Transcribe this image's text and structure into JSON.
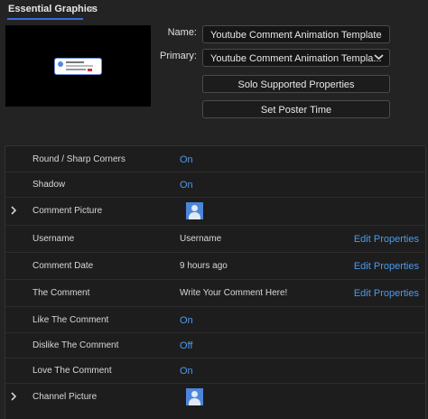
{
  "panel": {
    "title": "Essential Graphics",
    "menu_icon": "≡"
  },
  "template": {
    "name_label": "Name:",
    "name_value": "Youtube Comment Animation Template",
    "primary_label": "Primary:",
    "primary_value": "Youtube Comment Animation Templa...",
    "solo_button": "Solo Supported Properties",
    "poster_button": "Set Poster Time"
  },
  "properties": [
    {
      "label": "Round / Sharp Corners",
      "value": "On",
      "kind": "toggle"
    },
    {
      "label": "Shadow",
      "value": "On",
      "kind": "toggle"
    },
    {
      "label": "Comment Picture",
      "kind": "image",
      "icon": "user-placeholder-icon"
    },
    {
      "label": "Username",
      "value": "Username",
      "kind": "text",
      "action": "Edit Properties"
    },
    {
      "label": "Comment Date",
      "value": "9 hours ago",
      "kind": "text",
      "action": "Edit Properties"
    },
    {
      "label": "The Comment",
      "value": "Write Your Comment Here!",
      "kind": "text",
      "action": "Edit Properties"
    },
    {
      "label": "Like The Comment",
      "value": "On",
      "kind": "toggle"
    },
    {
      "label": "Dislike The Comment",
      "value": "Off",
      "kind": "toggle"
    },
    {
      "label": "Love The Comment",
      "value": "On",
      "kind": "toggle"
    },
    {
      "label": "Channel Picture",
      "kind": "image",
      "icon": "user-placeholder-icon"
    }
  ],
  "colors": {
    "link": "#4a9bf2",
    "background": "#232323",
    "accent": "#3a6fd8"
  }
}
